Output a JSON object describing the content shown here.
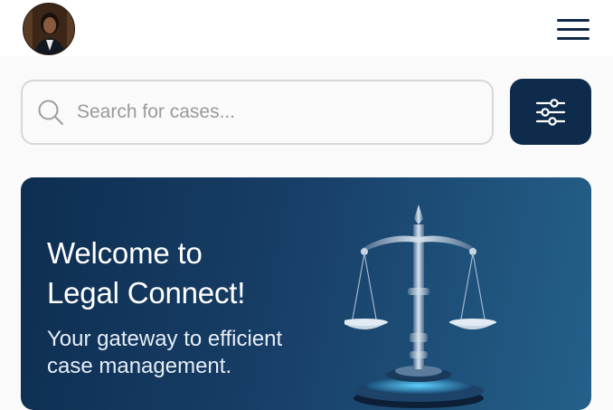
{
  "header": {
    "avatar_icon": "user-avatar",
    "menu_icon": "hamburger-menu-icon"
  },
  "search": {
    "placeholder": "Search for cases...",
    "icon": "search-icon"
  },
  "filter": {
    "icon": "sliders-icon"
  },
  "banner": {
    "title_line1": "Welcome to",
    "title_line2": "Legal Connect!",
    "subtitle_line1": "Your gateway to efficient",
    "subtitle_line2": "case management.",
    "image_icon": "scales-of-justice"
  },
  "colors": {
    "primary": "#0f2b4c",
    "banner_gradient_start": "#0e2e52",
    "banner_gradient_end": "#24608a",
    "text_on_dark": "#ffffff"
  }
}
